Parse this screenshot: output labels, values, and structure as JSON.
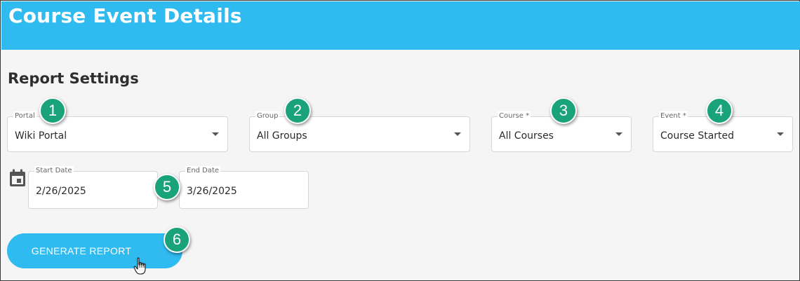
{
  "header": {
    "title": "Course Event Details"
  },
  "section": {
    "title": "Report Settings"
  },
  "fields": {
    "portal": {
      "label": "Portal",
      "value": "Wiki Portal"
    },
    "group": {
      "label": "Group",
      "value": "All Groups"
    },
    "course": {
      "label": "Course *",
      "value": "All Courses"
    },
    "event": {
      "label": "Event *",
      "value": "Course Started"
    },
    "start_date": {
      "label": "Start Date",
      "value": "2/26/2025"
    },
    "end_date": {
      "label": "End Date",
      "value": "3/26/2025"
    }
  },
  "badges": [
    "1",
    "2",
    "3",
    "4",
    "5",
    "6"
  ],
  "actions": {
    "generate_label": "GENERATE REPORT"
  },
  "icons": {
    "date": "calendar-icon",
    "cursor": "hand-pointer-icon",
    "dropdown": "caret-down-icon"
  },
  "colors": {
    "header": "#2fbaf0",
    "badge": "#1aa37a",
    "button": "#2fbaf0"
  }
}
